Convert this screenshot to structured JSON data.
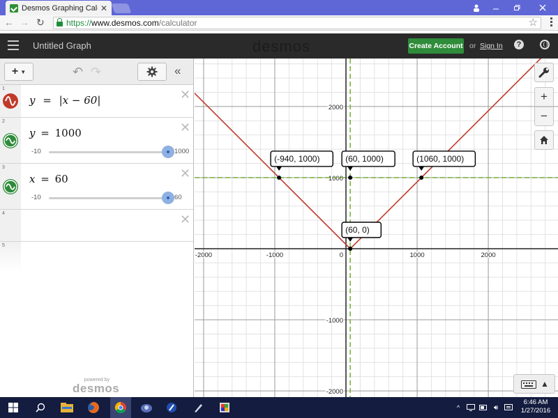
{
  "browser": {
    "tab_title": "Desmos Graphing Calculat",
    "url_scheme": "https://",
    "url_host": "www.desmos.com",
    "url_path": "/calculator"
  },
  "header": {
    "menu_icon": "hamburger-icon",
    "graph_title": "Untitled Graph",
    "logo_text": "desmos",
    "create_account_label": "Create Account",
    "or_text": "or",
    "sign_in_label": "Sign In",
    "help_label": "?"
  },
  "expressions": [
    {
      "index": "1",
      "latex_parts": [
        "y",
        "=",
        "|x − 60|"
      ],
      "color": "#c0392b",
      "icon": "graph-wave-icon"
    },
    {
      "index": "2",
      "latex_parts": [
        "y",
        "=",
        "1000"
      ],
      "color": "#2e8b3a",
      "icon": "slider-wave-icon",
      "slider": {
        "min_label": "-10",
        "max_label": "1000",
        "value": 1000,
        "min": -10,
        "max": 1000
      }
    },
    {
      "index": "3",
      "latex_parts": [
        "x",
        "=",
        "60"
      ],
      "color": "#2e8b3a",
      "icon": "slider-wave-icon",
      "slider": {
        "min_label": "-10",
        "max_label": "60",
        "value": 60,
        "min": -10,
        "max": 60
      }
    },
    {
      "index": "4"
    },
    {
      "index": "5"
    }
  ],
  "powered_by": {
    "small": "powered by",
    "brand": "desmos"
  },
  "graph": {
    "x_ticks": [
      {
        "value": -2000,
        "label": "-2000"
      },
      {
        "value": -1000,
        "label": "-1000"
      },
      {
        "value": 0,
        "label": "0"
      },
      {
        "value": 1000,
        "label": "1000"
      },
      {
        "value": 2000,
        "label": "2000"
      }
    ],
    "y_ticks": [
      {
        "value": 2000,
        "label": "2000"
      },
      {
        "value": 1000,
        "label": "1000"
      },
      {
        "value": -1000,
        "label": "-1000"
      },
      {
        "value": -2000,
        "label": "-2000"
      }
    ],
    "points": [
      {
        "x": -940,
        "y": 1000,
        "label": "(-940, 1000)"
      },
      {
        "x": 60,
        "y": 1000,
        "label": "(60, 1000)"
      },
      {
        "x": 1060,
        "y": 1000,
        "label": "(1060, 1000)"
      },
      {
        "x": 60,
        "y": 0,
        "label": "(60, 0)"
      }
    ],
    "colors": {
      "abs_line": "#c0392b",
      "dashed": "#7cb342",
      "axis": "#222",
      "grid_major": "#9a9a9a",
      "grid_minor": "#e2e2e2"
    }
  },
  "taskbar": {
    "time": "6:46 AM",
    "date": "1/27/2016",
    "apps": [
      "start-icon",
      "search-icon",
      "file-explorer-icon",
      "firefox-icon",
      "chrome-icon",
      "app-icon",
      "app-icon-2",
      "pen-icon",
      "shield-icon"
    ]
  }
}
